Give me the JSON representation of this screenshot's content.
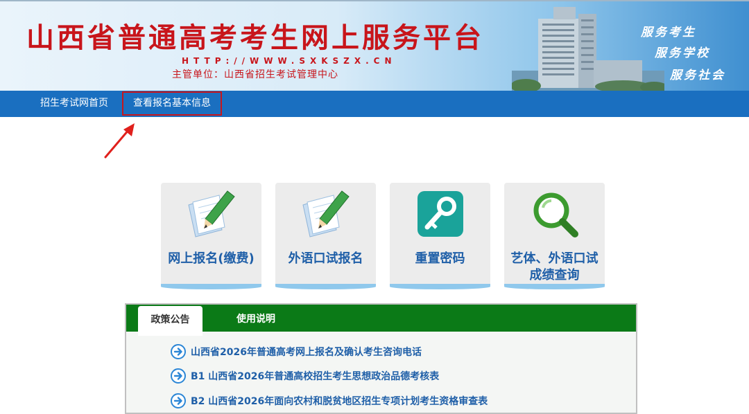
{
  "header": {
    "title": "山西省普通高考考生网上服务平台",
    "url": "HTTP://WWW.SXKSZX.CN",
    "subtitle": "主管单位：山西省招生考试管理中心",
    "slogans": [
      "服务考生",
      "服务学校",
      "服务社会"
    ]
  },
  "nav": {
    "items": [
      {
        "label": "招生考试网首页"
      },
      {
        "label": "查看报名基本信息"
      }
    ]
  },
  "tiles": [
    {
      "label": "网上报名(缴费)",
      "icon": "pencil-paper-icon"
    },
    {
      "label": "外语口试报名",
      "icon": "pencil-paper-icon"
    },
    {
      "label": "重置密码",
      "icon": "key-icon"
    },
    {
      "label_line1": "艺体、外语口试",
      "label_line2": "成绩查询",
      "icon": "magnifier-icon"
    }
  ],
  "notices": {
    "tabs": [
      {
        "label": "政策公告"
      },
      {
        "label": "使用说明"
      }
    ],
    "items": [
      {
        "text": "山西省2026年普通高考网上报名及确认考生咨询电话"
      },
      {
        "text": "B1 山西省2026年普通高校招生考生思想政治品德考核表"
      },
      {
        "text": "B2 山西省2026年面向农村和脱贫地区招生专项计划考生资格审查表"
      }
    ]
  },
  "colors": {
    "brand_red": "#c8151b",
    "nav_blue": "#1a6fc0",
    "tab_green": "#0b7a17",
    "link_blue": "#1f5fa8"
  }
}
